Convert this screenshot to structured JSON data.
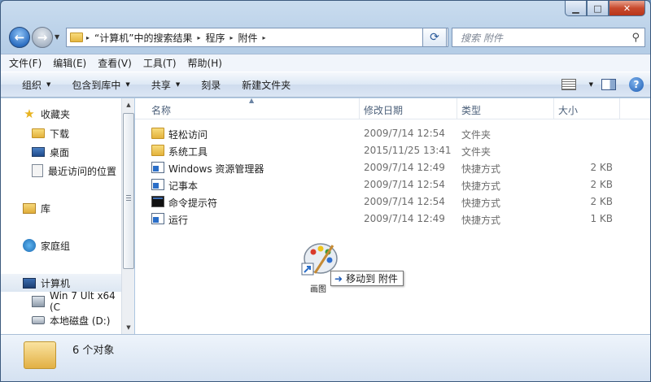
{
  "window": {
    "minimize": "▁",
    "maximize": "□",
    "close": "✕"
  },
  "address": {
    "crumbs": [
      "“计算机”中的搜索结果",
      "程序",
      "附件"
    ],
    "sep": "▸",
    "drop": "▼"
  },
  "search": {
    "placeholder": "搜索 附件",
    "icon": "⚲"
  },
  "nav": {
    "back": "←",
    "fwd": "→",
    "drop": "▼",
    "refresh": "⟳"
  },
  "menu": [
    "文件(F)",
    "编辑(E)",
    "查看(V)",
    "工具(T)",
    "帮助(H)"
  ],
  "toolbar": {
    "organize": "组织",
    "include": "包含到库中",
    "share": "共享",
    "burn": "刻录",
    "new_folder": "新建文件夹",
    "arrow": "▼",
    "help": "?"
  },
  "sidebar": {
    "favorites": "收藏夹",
    "downloads": "下载",
    "desktop": "桌面",
    "recent": "最近访问的位置",
    "libraries": "库",
    "homegroup": "家庭组",
    "computer": "计算机",
    "drive1": "Win 7 Ult x64 (C",
    "drive2": "本地磁盘 (D:)"
  },
  "columns": {
    "name": "名称",
    "date": "修改日期",
    "type": "类型",
    "size": "大小",
    "sort": "▲"
  },
  "files": [
    {
      "name": "轻松访问",
      "date": "2009/7/14 12:54",
      "type": "文件夹",
      "size": "",
      "icon": "folder-icon"
    },
    {
      "name": "系统工具",
      "date": "2015/11/25 13:41",
      "type": "文件夹",
      "size": "",
      "icon": "folder-icon"
    },
    {
      "name": "Windows 资源管理器",
      "date": "2009/7/14 12:49",
      "type": "快捷方式",
      "size": "2 KB",
      "icon": "shortcut-icon"
    },
    {
      "name": "记事本",
      "date": "2009/7/14 12:54",
      "type": "快捷方式",
      "size": "2 KB",
      "icon": "shortcut-icon"
    },
    {
      "name": "命令提示符",
      "date": "2009/7/14 12:54",
      "type": "快捷方式",
      "size": "2 KB",
      "icon": "cmd-icon"
    },
    {
      "name": "运行",
      "date": "2009/7/14 12:49",
      "type": "快捷方式",
      "size": "1 KB",
      "icon": "shortcut-icon"
    }
  ],
  "drag": {
    "label": "画图",
    "tip_arrow": "➜",
    "tip": "移动到 附件"
  },
  "status": {
    "count": "6 个对象"
  }
}
